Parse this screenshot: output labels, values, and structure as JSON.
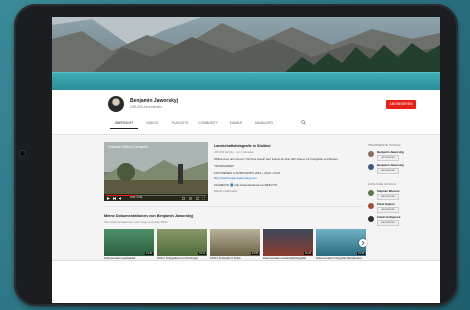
{
  "channel": {
    "name": "Benjamin Jaworskyj",
    "subscribers": "235.000 Abonnenten",
    "subscribe_label": "ABONNIEREN"
  },
  "tabs": [
    {
      "label": "ÜBERSICHT",
      "active": true
    },
    {
      "label": "VIDEOS",
      "active": false
    },
    {
      "label": "PLAYLISTS",
      "active": false
    },
    {
      "label": "COMMUNITY",
      "active": false
    },
    {
      "label": "KANÄLE",
      "active": false
    },
    {
      "label": "KANALINFO",
      "active": false
    }
  ],
  "featured": {
    "overlay_title": "Fotowalk Südtirol | Bergwelt ...",
    "progress": 0.3,
    "time": "0:00 / 9:34",
    "title": "Landschaftsfotografie in Südtirol",
    "meta": "235.000 Aufrufe · vor 4 Monaten",
    "desc": "Willkommen auf meinem YouTube Kanal! Hier findest du über 300 Videos zur Fotografie und Reisen.",
    "extra_label": "*SPONSORED*",
    "tour_label": "FOTOREISEN & WORKSHOPS 2018 + 2019 + FILM",
    "link1": "http://www.benjaminjaworskyj.com",
    "fb_line": "FACEBOOK 📘 http://www.facebook.com/BJFOTO",
    "more": "MEHR ANZEIGEN"
  },
  "shelf": {
    "title": "Meine Dokumentationen von Benjamin Jaworskyj",
    "subtitle": "Alle Dokumentationen und Vlogs auf einen Blick",
    "items": [
      {
        "caption": "Dokumentation spektakulär",
        "duration": "21:40"
      },
      {
        "caption": "DOKU: Fotografieren im Dschungel",
        "duration": "18:12"
      },
      {
        "caption": "DOKU: Fotosafari in Afrika",
        "duration": "24:05"
      },
      {
        "caption": "Dokumentation Landschaftsfotografie Island",
        "duration": "16:33"
      },
      {
        "caption": "Dokumentation Fotografie Skandinavien",
        "duration": "19:48"
      }
    ]
  },
  "sidebar": {
    "section1": "PROMINENTE KANÄLE",
    "section2": "ÄHNLICHE KANÄLE",
    "items": [
      {
        "name": "Benjamin Jaworskyj",
        "btn": "ABONNIEREN",
        "color": "#8a6d5a"
      },
      {
        "name": "Benjamin Jaworskyj",
        "btn": "ABONNIEREN",
        "color": "#3d5a80"
      },
      {
        "name": "Stephan Wiesner",
        "btn": "ABONNIEREN",
        "color": "#5a7a4a"
      },
      {
        "name": "Pavel Kaplun",
        "btn": "ABONNIEREN",
        "color": "#a05030"
      },
      {
        "name": "Calvin Hollywood",
        "btn": "ABONNIEREN",
        "color": "#303030"
      }
    ]
  },
  "colors": {
    "accent": "#e62117",
    "link": "#1a66c8"
  }
}
